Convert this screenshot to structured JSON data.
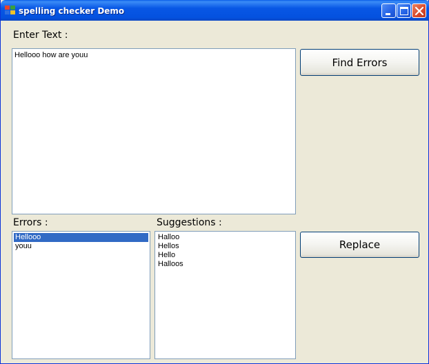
{
  "window": {
    "title": "spelling checker Demo",
    "icon": "app-icon"
  },
  "titlebar_buttons": {
    "minimize_icon": "minimize-icon",
    "maximize_icon": "maximize-icon",
    "close_icon": "close-icon"
  },
  "form": {
    "enter_text_label": "Enter Text :",
    "input_text": "Hellooo how are youu",
    "find_errors_label": "Find Errors",
    "errors_label": "Errors :",
    "suggestions_label": "Suggestions :",
    "replace_label": "Replace",
    "errors": [
      "Hellooo",
      "youu"
    ],
    "selected_error_index": 0,
    "suggestions": [
      "Halloo",
      "Hellos",
      "Hello",
      "Halloos"
    ]
  },
  "colors": {
    "selection": "#316AC5",
    "titlebar": "#0451DF",
    "background": "#ECE9D8"
  }
}
